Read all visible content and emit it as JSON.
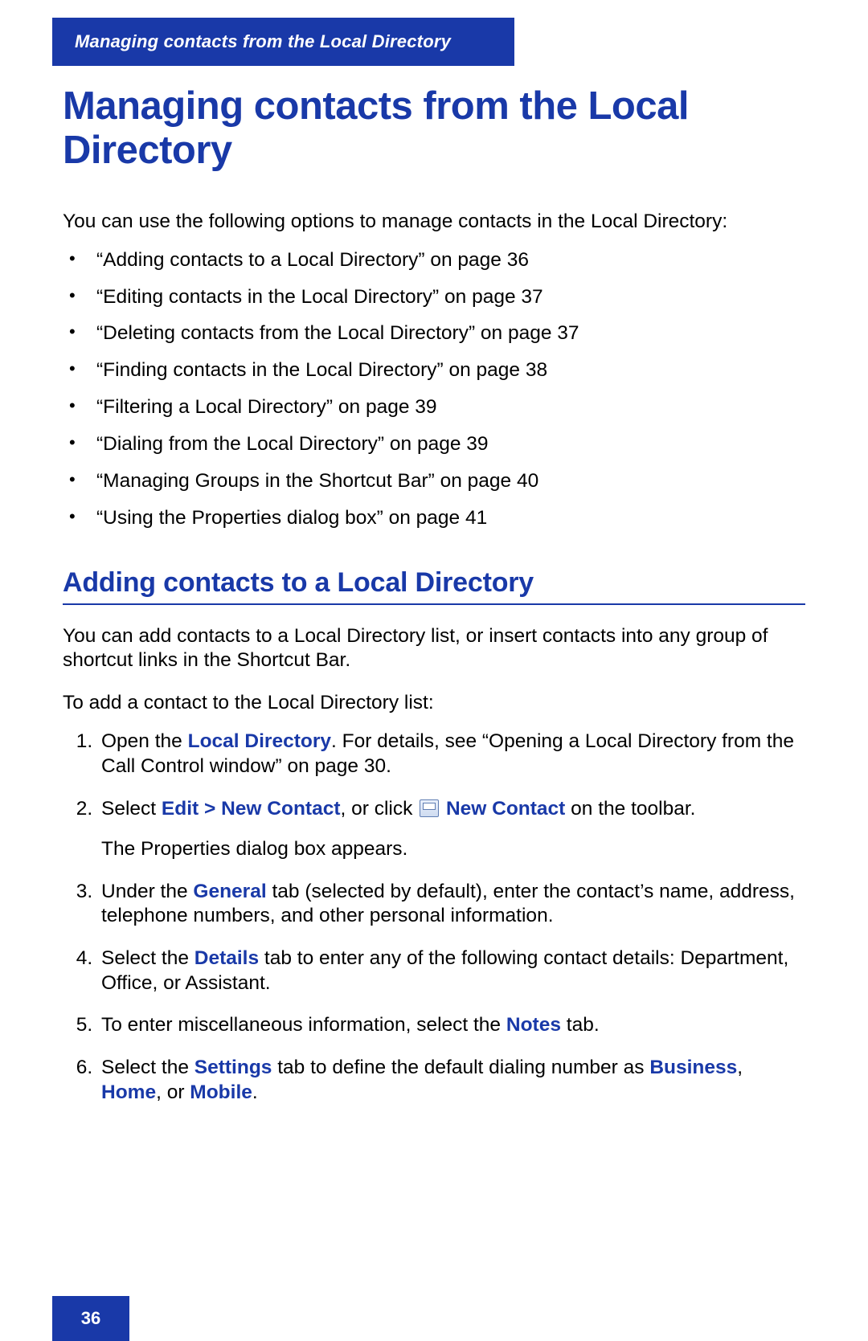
{
  "header": {
    "running_title": "Managing contacts from the Local Directory"
  },
  "title": "Managing contacts from the Local Directory",
  "intro": "You can use the following options to manage contacts in the Local Directory:",
  "toc": [
    "“Adding contacts to a Local Directory” on page 36",
    "“Editing contacts in the Local Directory” on page 37",
    "“Deleting contacts from the Local Directory” on page 37",
    "“Finding contacts in the Local Directory” on page 38",
    "“Filtering a Local Directory” on page 39",
    "“Dialing from the Local Directory” on page 39",
    "“Managing Groups in the Shortcut Bar” on page 40",
    "“Using the Properties dialog box” on page 41"
  ],
  "section": {
    "heading": "Adding contacts to a Local Directory",
    "para1": "You can add contacts to a Local Directory list, or insert contacts into any group of shortcut links in the Shortcut Bar.",
    "para2": "To add a contact to the Local Directory list:",
    "steps": {
      "s1": {
        "pre": "Open the ",
        "kw1": "Local Directory",
        "post": ". For details, see “Opening a Local Directory from the Call Control window” on page 30."
      },
      "s2": {
        "pre": "Select ",
        "kw1": "Edit > New Contact",
        "mid": ", or click ",
        "kw2": "New Contact",
        "post": " on the toolbar.",
        "sub": "The Properties dialog box appears."
      },
      "s3": {
        "pre": "Under the ",
        "kw1": "General",
        "post": " tab (selected by default), enter the contact’s name, address, telephone numbers, and other personal information."
      },
      "s4": {
        "pre": "Select the ",
        "kw1": "Details",
        "post": " tab to enter any of the following contact details: Department, Office, or Assistant."
      },
      "s5": {
        "pre": "To enter miscellaneous information, select the ",
        "kw1": "Notes",
        "post": " tab."
      },
      "s6": {
        "pre": "Select the ",
        "kw1": "Settings",
        "mid": " tab to define the default dialing number as ",
        "kw2": "Business",
        "sep1": ", ",
        "kw3": "Home",
        "sep2": ", or ",
        "kw4": "Mobile",
        "post": "."
      }
    }
  },
  "footer": {
    "page_number": "36"
  }
}
